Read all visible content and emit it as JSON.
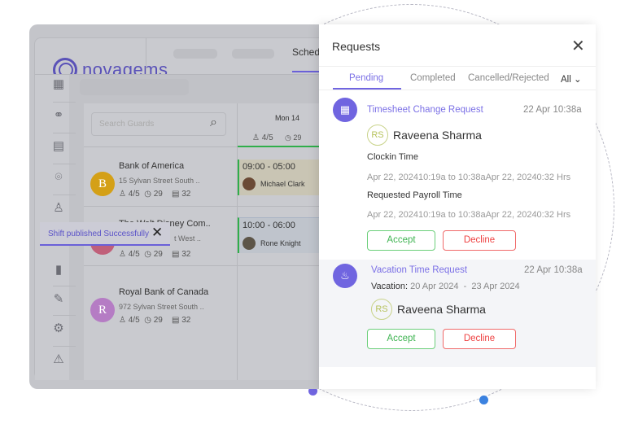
{
  "app": {
    "logo": "novagems",
    "nav_tab": "Sched",
    "search_placeholder": "Search Guards",
    "day": {
      "label": "Mon 14",
      "guards": "4/5",
      "hours": "29"
    },
    "sites": [
      {
        "initial": "B",
        "name": "Bank of America",
        "address": "15 Sylvan Street South ..",
        "guards": "4/5",
        "hours": "29",
        "days": "32",
        "color": "#d4a017"
      },
      {
        "initial": "T",
        "name": "The Walt Disney Com..",
        "address": "t West ..",
        "guards": "4/5",
        "hours": "29",
        "days": "32",
        "color": "#c0607a"
      },
      {
        "initial": "R",
        "name": "Royal Bank of Canada",
        "address": "972 Sylvan Street South ..",
        "guards": "4/5",
        "hours": "29",
        "days": "32",
        "color": "#b57cc4"
      }
    ],
    "shifts": [
      {
        "time": "09:00 - 05:00",
        "guard": "Michael Clark"
      },
      {
        "time": "10:00 - 06:00",
        "guard": "Rone Knight"
      }
    ],
    "toast": "Shift published Successfully"
  },
  "panel": {
    "title": "Requests",
    "tabs": [
      "Pending",
      "Completed",
      "Cancelled/Rejected"
    ],
    "filter": "All",
    "requests": [
      {
        "type": "Timesheet Change Request",
        "time": "22 Apr 10:38a",
        "initials": "RS",
        "name": "Raveena Sharma",
        "clockin_label": "Clockin Time",
        "clockin_value": "Apr 22, 202410:19a to 10:38aApr 22, 20240:32 Hrs",
        "payroll_label": "Requested Payroll Time",
        "payroll_value": "Apr 22, 202410:19a to 10:38aApr 22, 20240:32 Hrs",
        "accept": "Accept",
        "decline": "Decline"
      },
      {
        "type": "Vacation Time Request",
        "time": "22 Apr 10:38a",
        "vacation_label": "Vacation:",
        "vacation_value": "20 Apr 2024  -  23 Apr 2024",
        "initials": "RS",
        "name": "Raveena Sharma",
        "accept": "Accept",
        "decline": "Decline"
      }
    ]
  },
  "colors": {
    "accent": "#7065e0",
    "accept": "#3fb452",
    "decline": "#ee4040"
  }
}
